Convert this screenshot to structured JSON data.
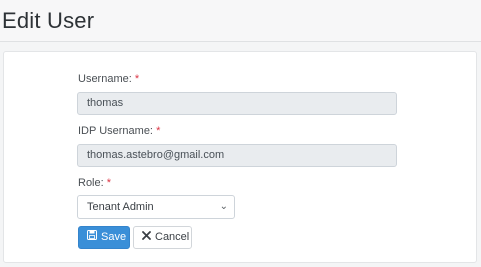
{
  "page": {
    "title": "Edit User"
  },
  "form": {
    "username_label": "Username:",
    "idp_username_label": "IDP Username:",
    "role_label": "Role:",
    "required_mark": "*",
    "username_value": "thomas",
    "idp_username_value": "thomas.astebro@gmail.com",
    "role_value": "Tenant Admin"
  },
  "buttons": {
    "save_label": "Save",
    "cancel_label": "Cancel"
  },
  "icons": {
    "save": "floppy-disk-icon",
    "cancel": "close-icon",
    "select": "chevron-down-icon"
  },
  "colors": {
    "primary": "#3a8fd8",
    "required": "#dc3545"
  }
}
